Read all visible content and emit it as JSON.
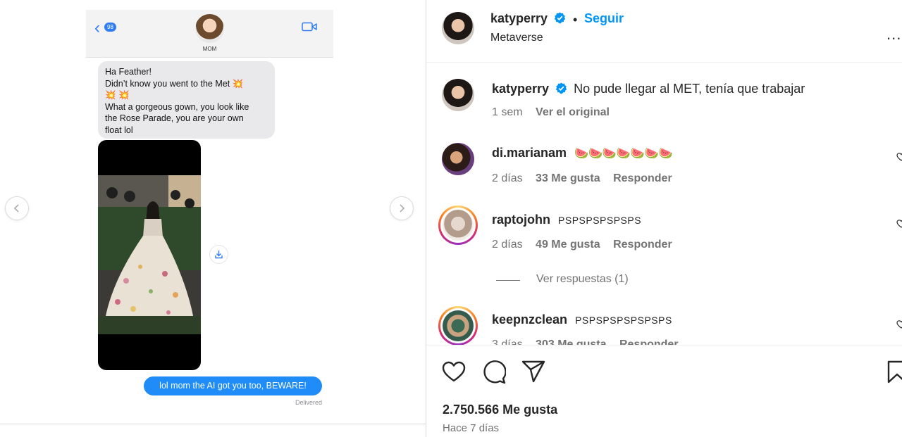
{
  "media": {
    "imessage": {
      "back_count": "98",
      "contact_name": "MOM",
      "incoming_lines": [
        "Ha Feather!",
        "Didn’t know you went to the Met 💥",
        "💥 💥",
        "What a gorgeous gown, you look like",
        "the Rose Parade, you are your own",
        "float lol"
      ],
      "outgoing": "lol mom the AI got you too, BEWARE!",
      "status": "Delivered"
    }
  },
  "post": {
    "author": "katyperry",
    "follow_label": "Seguir",
    "separator": "•",
    "location": "Metaverse",
    "more_label": "...",
    "caption": {
      "user": "katyperry",
      "text": "No pude llegar al MET, tenía que trabajar",
      "age": "1 sem",
      "see_original": "Ver el original"
    },
    "comments": [
      {
        "user": "di.marianam",
        "text": "🍉🍉🍉🍉🍉🍉🍉",
        "age": "2 días",
        "likes": "33 Me gusta",
        "reply": "Responder"
      },
      {
        "user": "raptojohn",
        "text": "PSPSPSPSPSPS",
        "age": "2 días",
        "likes": "49 Me gusta",
        "reply": "Responder",
        "view_replies": "Ver respuestas (1)"
      },
      {
        "user": "keepnzclean",
        "text": "PSPSPSPSPSPSPS",
        "age": "3 días",
        "likes": "303 Me gusta",
        "reply": "Responder"
      }
    ],
    "likes_count": "2.750.566 Me gusta",
    "posted": "Hace 7 días"
  },
  "colors": {
    "link_blue": "#0095f6",
    "verified_blue": "#0095f6",
    "imessage_blue": "#1f8cf7",
    "text_primary": "#262626",
    "text_secondary": "#737373"
  },
  "icons": [
    "chevron-left-icon",
    "chevron-right-icon",
    "facetime-icon",
    "save-icon",
    "verified-icon",
    "more-icon",
    "heart-icon",
    "comment-icon",
    "share-icon",
    "bookmark-icon"
  ]
}
